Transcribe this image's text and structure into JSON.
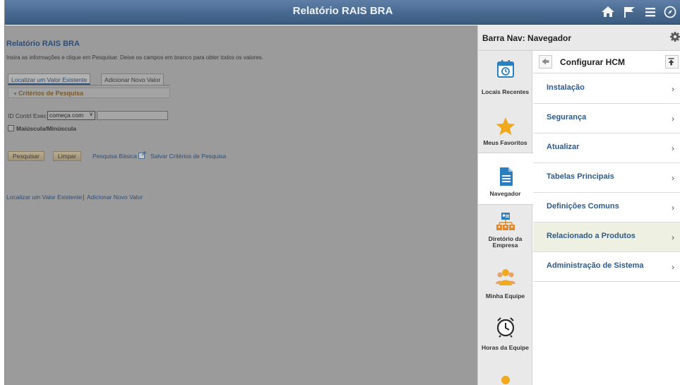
{
  "banner": {
    "title": "Relatório RAIS BRA",
    "icons": [
      "home-icon",
      "flag-icon",
      "menu-icon",
      "compass-icon"
    ]
  },
  "page": {
    "title": "Relatório RAIS BRA",
    "instructions": "Insira as informações e clique em Pesquisar. Deixe os campos em branco para obter todos os valores.",
    "tabs": [
      "Localizar um Valor Existente",
      "Adicionar Novo Valor"
    ],
    "criteria_header": "Critérios de Pesquisa",
    "field_label": "ID Contrl Exec",
    "operator_value": "começa com",
    "field_value": "",
    "case_label": "Maiúscula/Minúscula",
    "search_button": "Pesquisar",
    "clear_button": "Limpar",
    "basic_search_link": "Pesquisa Básica",
    "save_criteria_link": "Salvar Critérios de Pesquisa",
    "bottom_links": [
      "Localizar um Valor Existente",
      "Adicionar Novo Valor"
    ],
    "link_separator": "|"
  },
  "nav_panel": {
    "title": "Barra Nav: Navegador",
    "rail": [
      {
        "label": "Locais Recentes",
        "icon": "calendar-clock-icon"
      },
      {
        "label": "Meus Favoritos",
        "icon": "star-icon"
      },
      {
        "label": "Navegador",
        "icon": "document-icon",
        "selected": true
      },
      {
        "label": "Diretório da Empresa",
        "icon": "org-chart-icon"
      },
      {
        "label": "Minha Equipe",
        "icon": "team-icon"
      },
      {
        "label": "Horas da Equipe",
        "icon": "alarm-clock-icon"
      }
    ],
    "section_title": "Configurar HCM",
    "menu": [
      {
        "label": "Instalação"
      },
      {
        "label": "Segurança"
      },
      {
        "label": "Atualizar"
      },
      {
        "label": "Tabelas Principais"
      },
      {
        "label": "Definições Comuns"
      },
      {
        "label": "Relacionado a Produtos",
        "highlighted": true
      },
      {
        "label": "Administração de Sistema"
      }
    ],
    "chevron": "›"
  },
  "colors": {
    "banner": "#48698f",
    "overlay_gray": "#9b9b9b",
    "link_blue": "#2c5a8a",
    "highlight_row": "#eef0e1"
  }
}
